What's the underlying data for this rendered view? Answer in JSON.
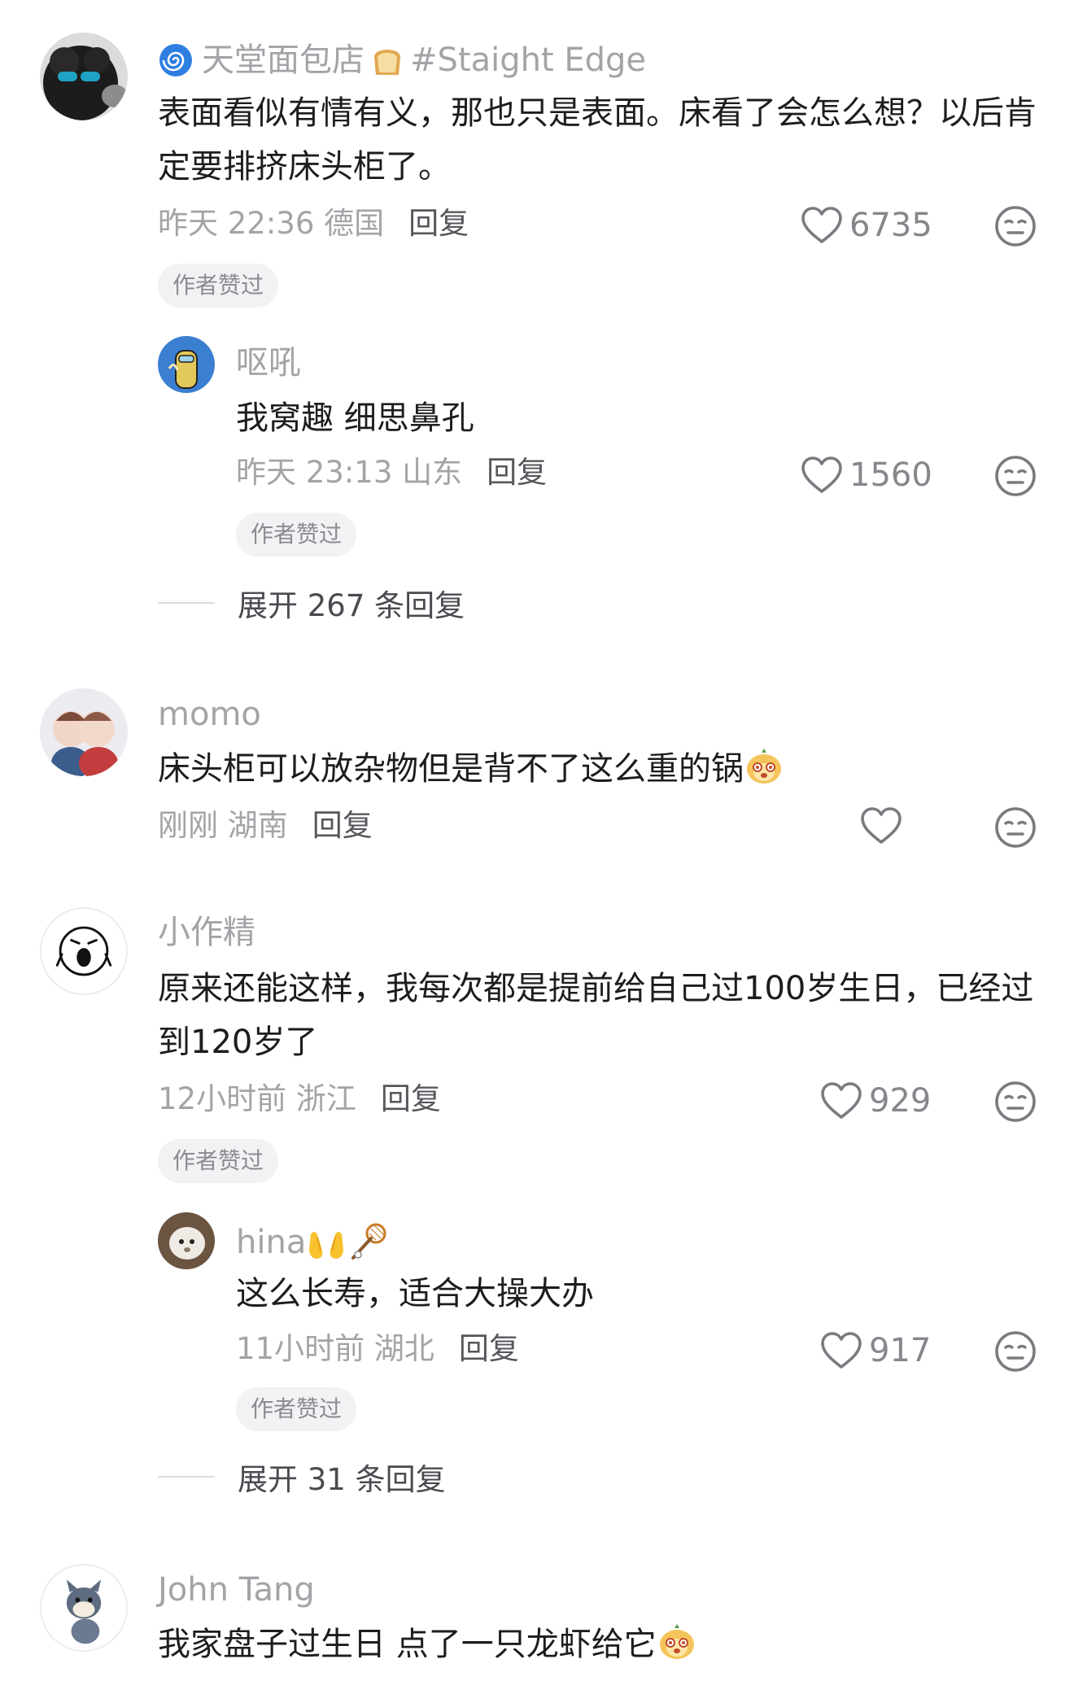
{
  "comments": [
    {
      "username": "天堂面包店",
      "username_tag": "#Staight Edge",
      "text": "表面看似有情有义，那也只是表面。床看了会怎么想？以后肯定要排挤床头柜了。",
      "time": "昨天 22:36 德国",
      "reply_label": "回复",
      "likes": "6735",
      "badge": "作者赞过",
      "replies": [
        {
          "username": "呕吼",
          "text": "我窝趣 细思鼻孔",
          "time": "昨天 23:13 山东",
          "reply_label": "回复",
          "likes": "1560",
          "badge": "作者赞过"
        }
      ],
      "expand_label": "展开 267 条回复"
    },
    {
      "username": "momo",
      "text": "床头柜可以放杂物但是背不了这么重的锅",
      "time": "刚刚 湖南",
      "reply_label": "回复",
      "likes": ""
    },
    {
      "username": "小作精",
      "text": "原来还能这样，我每次都是提前给自己过100岁生日，已经过到120岁了",
      "time": "12小时前 浙江",
      "reply_label": "回复",
      "likes": "929",
      "badge": "作者赞过",
      "replies": [
        {
          "username": "hina",
          "text": "这么长寿，适合大操大办",
          "time": "11小时前 湖北",
          "reply_label": "回复",
          "likes": "917",
          "badge": "作者赞过"
        }
      ],
      "expand_label": "展开 31 条回复"
    },
    {
      "username": "John Tang",
      "text": "我家盘子过生日 点了一只龙虾给它"
    }
  ],
  "icons": [
    "heart-icon",
    "dislike-face-icon",
    "spiral-emoji-icon",
    "bread-emoji-icon",
    "bear-emoji-icon",
    "clap-emoji-icon",
    "badminton-emoji-icon"
  ],
  "colors": {
    "meta": "#a3a3a8",
    "text": "#1d1d20",
    "badge_bg": "#f2f2f4"
  }
}
